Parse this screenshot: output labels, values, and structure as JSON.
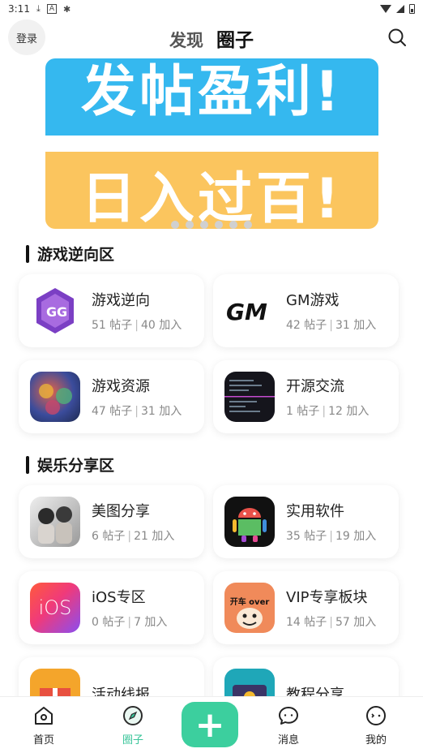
{
  "status": {
    "time": "3:11",
    "icons": [
      "download-icon",
      "a-icon",
      "bug-icon"
    ]
  },
  "header": {
    "login": "登录",
    "tabs": [
      {
        "label": "发现"
      },
      {
        "label": "圈子"
      }
    ],
    "active_tab": 1
  },
  "banner": {
    "line1": "发帖盈利!",
    "line2": "日入过百!",
    "colors": {
      "top": "#35b8ef",
      "bottom": "#fbc55e"
    },
    "dots": 6
  },
  "sections": [
    {
      "title": "游戏逆向区",
      "cards": [
        {
          "name": "游戏逆向",
          "posts": "51 帖子",
          "joins": "40 加入",
          "icon": "gg-icon"
        },
        {
          "name": "GM游戏",
          "posts": "42 帖子",
          "joins": "31 加入",
          "icon": "gm-logo-icon"
        },
        {
          "name": "游戏资源",
          "posts": "47 帖子",
          "joins": "31 加入",
          "icon": "game-art-icon"
        },
        {
          "name": "开源交流",
          "posts": "1 帖子",
          "joins": "12 加入",
          "icon": "terminal-icon"
        }
      ]
    },
    {
      "title": "娱乐分享区",
      "cards": [
        {
          "name": "美图分享",
          "posts": "6 帖子",
          "joins": "21 加入",
          "icon": "photo-icon"
        },
        {
          "name": "实用软件",
          "posts": "35 帖子",
          "joins": "19 加入",
          "icon": "android-icon"
        },
        {
          "name": "iOS专区",
          "posts": "0 帖子",
          "joins": "7 加入",
          "icon": "ios-icon"
        },
        {
          "name": "VIP专享板块",
          "posts": "14 帖子",
          "joins": "57 加入",
          "icon": "meme-icon",
          "icon_text": "开车 over"
        },
        {
          "name": "活动线报",
          "posts": "",
          "joins": "",
          "icon": "gift-icon"
        },
        {
          "name": "教程分享",
          "posts": "",
          "joins": "",
          "icon": "video-icon"
        }
      ]
    }
  ],
  "ios_text": "iOS",
  "nav": {
    "items": [
      {
        "label": "首页",
        "icon": "home-icon"
      },
      {
        "label": "圈子",
        "icon": "compass-icon"
      },
      {
        "label": "消息",
        "icon": "chat-icon"
      },
      {
        "label": "我的",
        "icon": "profile-icon"
      }
    ],
    "plus": "+",
    "accent": "#3ccf9e"
  }
}
